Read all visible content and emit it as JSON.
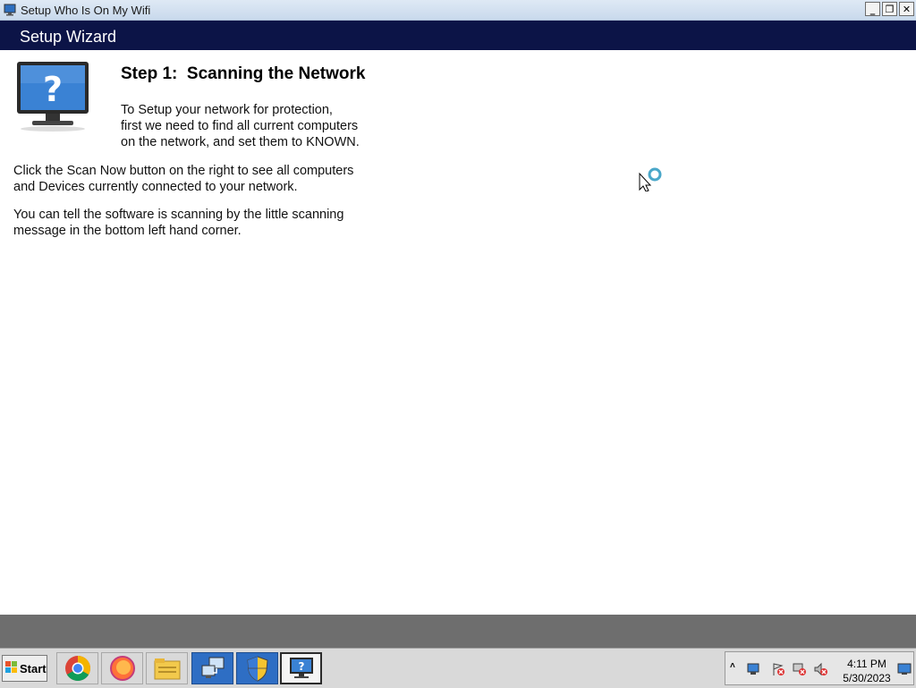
{
  "window": {
    "title": "Setup Who Is On My Wifi",
    "controls": {
      "minimize": "_",
      "restore": "❐",
      "close": "✕"
    }
  },
  "header": {
    "title": "Setup Wizard",
    "background": "#0c1447"
  },
  "content": {
    "step_title": "Step 1:  Scanning the Network",
    "intro_lines": [
      "To Setup your network for protection,",
      "first we need to find all current computers",
      "on the network, and set them to KNOWN."
    ],
    "paragraph1_lines": [
      "Click the Scan Now button on the right to see all computers",
      "and Devices currently connected to your network."
    ],
    "paragraph2_lines": [
      "You can tell the software is scanning by the little scanning",
      "message in the bottom left hand corner."
    ],
    "icon": "monitor-question-icon"
  },
  "taskbar": {
    "start_label": "Start",
    "apps": [
      "chrome-icon",
      "firefox-icon",
      "file-explorer-icon",
      "network-computer-icon",
      "security-shield-icon",
      "who-is-on-my-wifi-icon"
    ],
    "tray": {
      "time": "4:11 PM",
      "date": "5/30/2023",
      "icons": [
        "show-hidden-icons-chevron",
        "network-monitor-icon",
        "flag-error-icon",
        "network-error-icon",
        "volume-muted-icon",
        "show-desktop-icon"
      ]
    }
  }
}
